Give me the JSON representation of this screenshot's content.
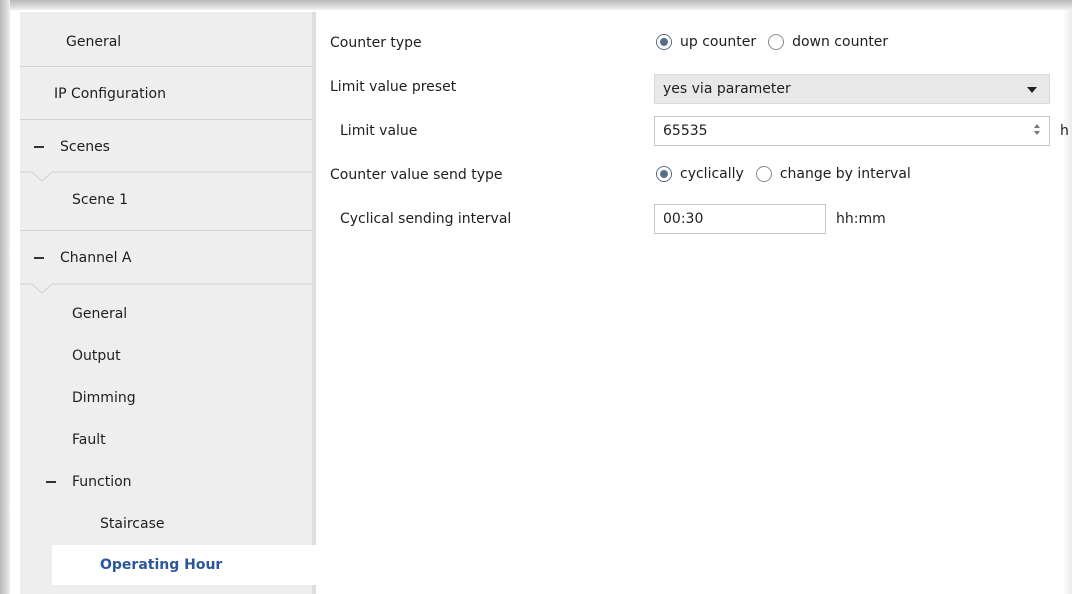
{
  "sidebar": {
    "items": [
      {
        "label": "General"
      },
      {
        "label": "IP Configuration"
      },
      {
        "label": "Scenes"
      },
      {
        "label": "Scene 1"
      },
      {
        "label": "Channel A"
      },
      {
        "label": "General"
      },
      {
        "label": "Output"
      },
      {
        "label": "Dimming"
      },
      {
        "label": "Fault"
      },
      {
        "label": "Function"
      },
      {
        "label": "Staircase"
      },
      {
        "label": "Operating Hour"
      }
    ]
  },
  "params": {
    "counter_type": {
      "label": "Counter type",
      "options": [
        "up counter",
        "down counter"
      ],
      "selected": "up counter"
    },
    "limit_preset": {
      "label": "Limit value preset",
      "value": "yes via parameter"
    },
    "limit_value": {
      "label": "Limit value",
      "value": "65535",
      "unit": "h"
    },
    "send_type": {
      "label": "Counter value send type",
      "options": [
        "cyclically",
        "change by interval"
      ],
      "selected": "cyclically"
    },
    "interval": {
      "label": "Cyclical sending interval",
      "value": "00:30",
      "unit": "hh:mm"
    }
  },
  "colors": {
    "active_text": "#2b579a",
    "sidebar_bg": "#eeeeee",
    "radio_selected": "#5a6d86"
  }
}
